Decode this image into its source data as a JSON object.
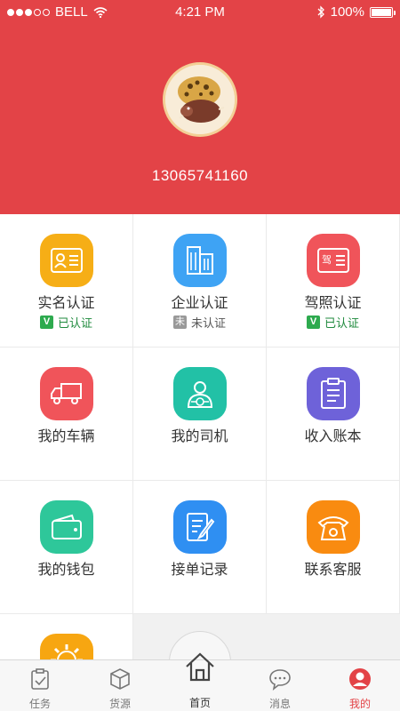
{
  "status_bar": {
    "carrier": "BELL",
    "time": "4:21 PM",
    "battery": "100%",
    "battery_level": 1.0
  },
  "profile": {
    "phone": "13065741160"
  },
  "menu": [
    {
      "label": "实名认证",
      "status": "已认证",
      "status_mark": "V",
      "verified": true,
      "color": "#f6ae16",
      "icon": "id-card-icon"
    },
    {
      "label": "企业认证",
      "status": "未认证",
      "status_mark": "未",
      "verified": false,
      "color": "#3ea3f4",
      "icon": "building-icon"
    },
    {
      "label": "驾照认证",
      "status": "已认证",
      "status_mark": "V",
      "verified": true,
      "color": "#f0545a",
      "icon": "license-icon"
    },
    {
      "label": "我的车辆",
      "color": "#f0545a",
      "icon": "truck-icon"
    },
    {
      "label": "我的司机",
      "color": "#22c1a6",
      "icon": "driver-icon"
    },
    {
      "label": "收入账本",
      "color": "#6e62d9",
      "icon": "ledger-icon"
    },
    {
      "label": "我的钱包",
      "color": "#2ec79a",
      "icon": "wallet-icon"
    },
    {
      "label": "接单记录",
      "color": "#2f8ff2",
      "icon": "order-record-icon"
    },
    {
      "label": "联系客服",
      "color": "#f98b10",
      "icon": "telephone-icon"
    }
  ],
  "partial_item": {
    "color": "#f7a611",
    "icon": "settings-icon"
  },
  "tabbar": {
    "tabs": [
      {
        "label": "任务",
        "icon": "task-icon",
        "active": false
      },
      {
        "label": "货源",
        "icon": "box-icon",
        "active": false
      },
      {
        "label": "首页",
        "icon": "home-icon",
        "active": false
      },
      {
        "label": "消息",
        "icon": "message-icon",
        "active": false
      },
      {
        "label": "我的",
        "icon": "profile-icon",
        "active": true
      }
    ]
  },
  "colors": {
    "header_bg": "#e34347",
    "accent": "#e34347",
    "verified_green": "#2daa4e"
  }
}
